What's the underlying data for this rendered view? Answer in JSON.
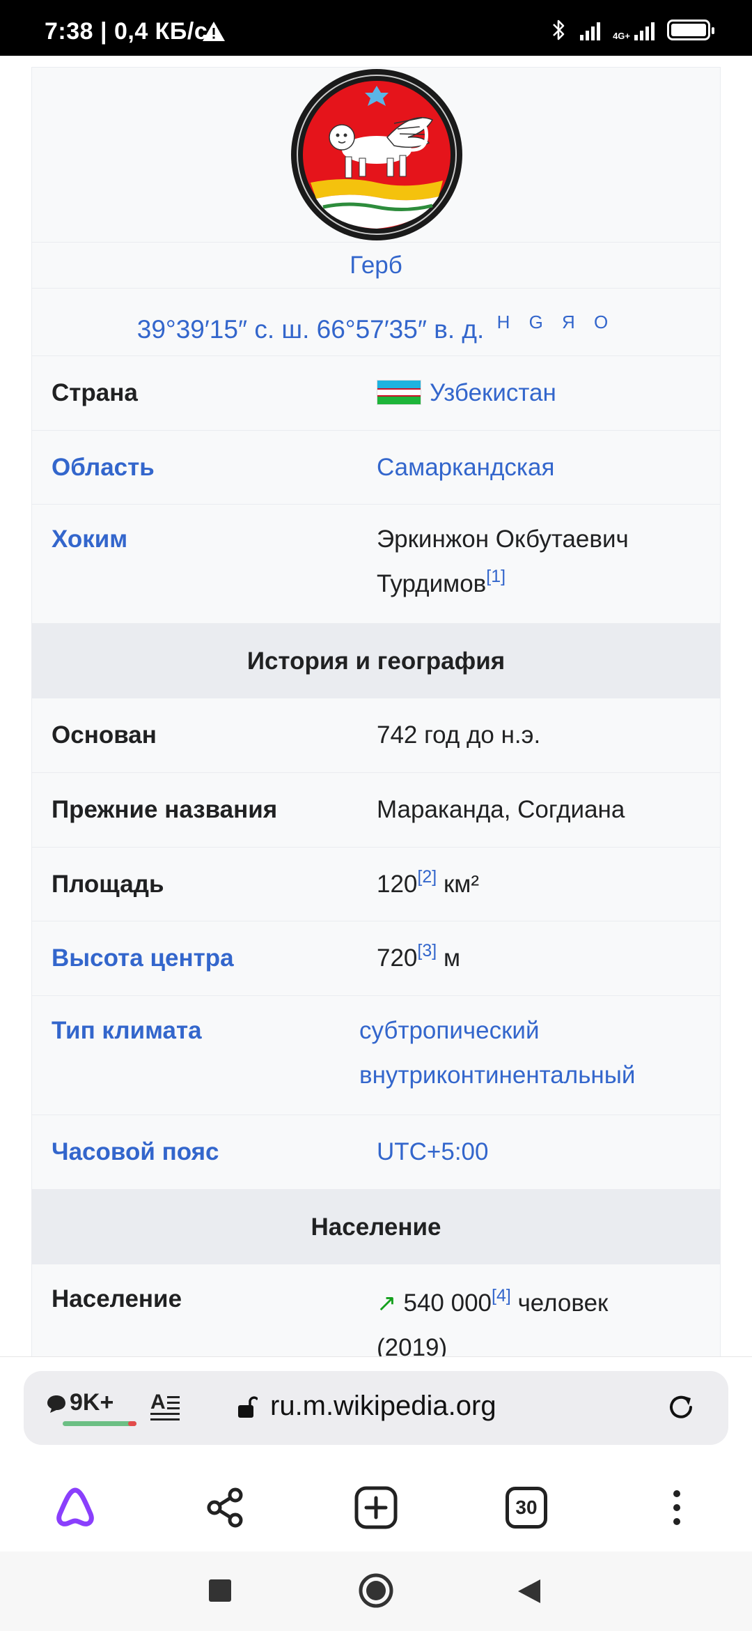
{
  "status_bar": {
    "time": "7:38",
    "speed": "0,4 КБ/с",
    "network": "4G+"
  },
  "infobox": {
    "emblem_caption": "Герб",
    "coordinates": "39°39′15″ с. ш. 66°57′35″ в. д.",
    "coord_links": "H G Я O",
    "rows_top": [
      {
        "label": "Страна",
        "value": "Узбекистан",
        "ref": ""
      },
      {
        "label": "Область",
        "value": "Самаркандская",
        "ref": ""
      },
      {
        "label": "Хоким",
        "value_line1": "Эркинжон Окбутаевич",
        "value_line2": "Турдимов",
        "ref": "[1]"
      }
    ],
    "section_history": "История и география",
    "rows_history": [
      {
        "label": "Основан",
        "value": "742 год до н.э."
      },
      {
        "label": "Прежние названия",
        "value": "Мараканда, Согдиана"
      },
      {
        "label": "Площадь",
        "value": "120",
        "ref": "[2]",
        "unit": "км²"
      },
      {
        "label": "Высота центра",
        "value": "720",
        "ref": "[3]",
        "unit": "м"
      },
      {
        "label": "Тип климата",
        "value_line1": "субтропический",
        "value_line2": "внутриконтинентальный"
      },
      {
        "label": "Часовой пояс",
        "value": "UTC+5:00"
      }
    ],
    "section_population": "Население",
    "rows_population": [
      {
        "label": "Население",
        "value": "540 000",
        "ref": "[4]",
        "unit": "человек",
        "year": "(2019)"
      }
    ]
  },
  "browser": {
    "comments_count": "9K+",
    "url": "ru.m.wikipedia.org",
    "tabs_count": "30"
  },
  "icons": {
    "warning": "warning-icon",
    "bluetooth": "bluetooth-icon",
    "battery": "battery-icon",
    "comments": "comment-bubble-icon",
    "reader": "reader-mode-icon",
    "lock": "lock-icon",
    "reload": "reload-icon",
    "alice": "alice-assistant-icon",
    "share": "share-icon",
    "new_tab": "new-tab-icon",
    "menu": "more-vertical-icon"
  },
  "colors": {
    "link": "#3366cc",
    "section_bg": "#eaecf0",
    "infobox_bg": "#f8f9fa",
    "emblem_red": "#e5141b",
    "alice_purple": "#8a3ffc"
  }
}
